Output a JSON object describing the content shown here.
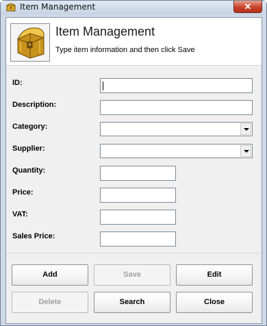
{
  "window": {
    "title": "Item Management",
    "close_glyph": "✕"
  },
  "header": {
    "title": "Item Management",
    "subtitle": "Type item information and then click Save",
    "icon": "treasure-chest-icon"
  },
  "form": {
    "id_label": "ID:",
    "id_value": "",
    "description_label": "Description:",
    "description_value": "",
    "category_label": "Category:",
    "category_value": "",
    "supplier_label": "Supplier:",
    "supplier_value": "",
    "quantity_label": "Quantity:",
    "quantity_value": "",
    "price_label": "Price:",
    "price_value": "",
    "vat_label": "VAT:",
    "vat_value": "",
    "sales_price_label": "Sales Price:",
    "sales_price_value": ""
  },
  "buttons": {
    "add": "Add",
    "save": "Save",
    "edit": "Edit",
    "delete": "Delete",
    "search": "Search",
    "close": "Close"
  },
  "colors": {
    "window_frame": "#cfd9e6",
    "close_button": "#c9442c",
    "disabled_text": "#a0a0a0"
  }
}
